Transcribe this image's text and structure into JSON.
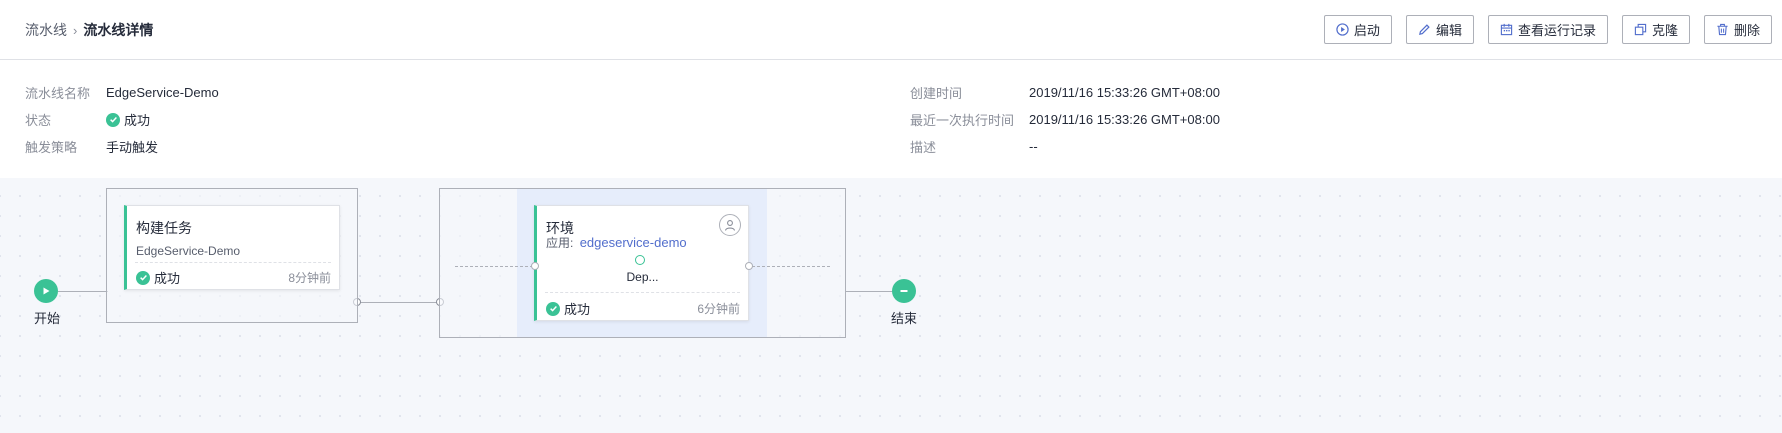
{
  "breadcrumb": {
    "parent": "流水线",
    "separator": "›",
    "current": "流水线详情"
  },
  "toolbar": {
    "start": "启动",
    "edit": "编辑",
    "history": "查看运行记录",
    "clone": "克隆",
    "delete": "删除"
  },
  "info": {
    "name_label": "流水线名称",
    "name_value": "EdgeService-Demo",
    "status_label": "状态",
    "status_value": "成功",
    "trigger_label": "触发策略",
    "trigger_value": "手动触发",
    "created_label": "创建时间",
    "created_value": "2019/11/16 15:33:26 GMT+08:00",
    "last_run_label": "最近一次执行时间",
    "last_run_value": "2019/11/16 15:33:26 GMT+08:00",
    "desc_label": "描述",
    "desc_value": "--"
  },
  "flow": {
    "start_label": "开始",
    "end_label": "结束",
    "build": {
      "title": "构建任务",
      "subtitle": "EdgeService-Demo",
      "status": "成功",
      "time": "8分钟前"
    },
    "deploy": {
      "title": "环境",
      "app_prefix": "应用:",
      "app_link": "edgeservice-demo",
      "step": "Dep...",
      "status": "成功",
      "time": "6分钟前"
    }
  },
  "colors": {
    "success": "#3ac295",
    "link": "#526ecc",
    "accent_bg": "#e6edfb"
  },
  "icons": [
    "play-circle-icon",
    "pencil-icon",
    "calendar-icon",
    "copy-icon",
    "trash-icon",
    "check-circle-icon",
    "user-icon"
  ]
}
